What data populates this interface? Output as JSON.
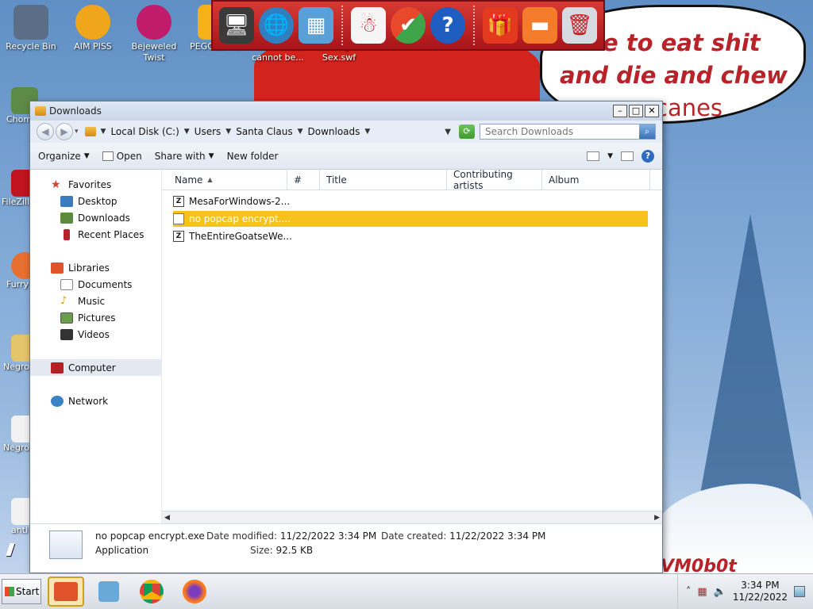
{
  "background": {
    "bubble_line1": "time to eat shit",
    "bubble_line2": "and die and chew",
    "bubble_line3": "canes",
    "bottom_text": "VM0b0t"
  },
  "desktop_icons": [
    {
      "label": "Recycle Bin",
      "color": "#5b6e87"
    },
    {
      "label": "AIM PISS",
      "color": "#f0a61b"
    },
    {
      "label": "Bejeweled Twist",
      "color": "#c11b6b"
    },
    {
      "label": "PEGGLE ME",
      "color": "#f6b11a"
    },
    {
      "label": "I SERIOUSLY cannot be...",
      "color": "#4d8fd6"
    },
    {
      "label": "Binding Of Sex.swf",
      "color": "#e7e9ee"
    }
  ],
  "desktop_left": [
    {
      "label": "Chom",
      "color": "#5d8a46"
    },
    {
      "label": "FileZill",
      "color": "#c1121f"
    },
    {
      "label": "Furry",
      "color": "#e76f2f"
    },
    {
      "label": "Negro",
      "color": "#e3c56b"
    },
    {
      "label": "Negro",
      "color": "#f2f2f2"
    },
    {
      "label": "anti",
      "color": "#f2f2f2"
    }
  ],
  "top_toolbar": {
    "icons": [
      "computer-santa-icon",
      "globe-icon",
      "network-icon",
      "snowman-icon",
      "windows-logo-icon",
      "help-icon",
      "gift-icon",
      "folder-icon",
      "trash-icon"
    ]
  },
  "window": {
    "title": "Downloads",
    "address": {
      "crumbs": [
        "Local Disk (C:)",
        "Users",
        "Santa Claus",
        "Downloads"
      ]
    },
    "search_placeholder": "Search Downloads",
    "commands": {
      "organize": "Organize",
      "open": "Open",
      "share_with": "Share with",
      "new_folder": "New folder"
    },
    "nav": {
      "favorites": "Favorites",
      "desktop": "Desktop",
      "downloads": "Downloads",
      "recent_places": "Recent Places",
      "libraries": "Libraries",
      "documents": "Documents",
      "music": "Music",
      "pictures": "Pictures",
      "videos": "Videos",
      "computer": "Computer",
      "network": "Network"
    },
    "columns": {
      "name": "Name",
      "number": "#",
      "title": "Title",
      "contributing_artists": "Contributing artists",
      "album": "Album"
    },
    "files": [
      {
        "name": "MesaForWindows-2...",
        "selected": false
      },
      {
        "name": "no popcap encrypt....",
        "selected": true
      },
      {
        "name": "TheEntireGoatseWe...",
        "selected": false
      }
    ],
    "details": {
      "filename": "no popcap encrypt.exe",
      "type": "Application",
      "date_modified_label": "Date modified:",
      "date_modified": "11/22/2022 3:34 PM",
      "size_label": "Size:",
      "size": "92.5 KB",
      "date_created_label": "Date created:",
      "date_created": "11/22/2022 3:34 PM"
    }
  },
  "taskbar": {
    "start_label": "Start",
    "time": "3:34 PM",
    "date": "11/22/2022"
  },
  "colors": {
    "selection": "#f7c21b",
    "taskbar_active": "#fbe4b4",
    "toolbar_red": "#c21b20"
  }
}
